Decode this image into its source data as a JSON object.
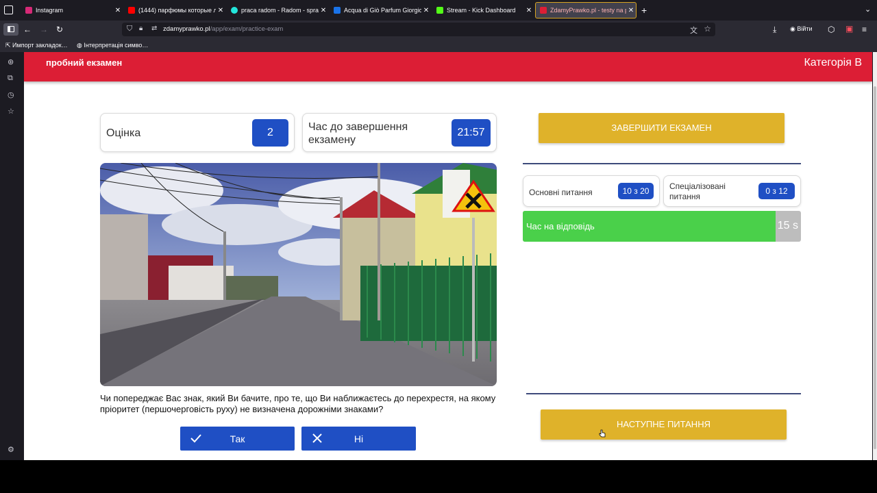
{
  "browser": {
    "tabs": [
      {
        "title": "Instagram",
        "color": "#d62976",
        "active": false
      },
      {
        "title": "(1444) парфюмы которые л",
        "color": "#ff0000",
        "active": false
      },
      {
        "title": "praca radom - Radom - spra",
        "color": "#23e5db",
        "active": false
      },
      {
        "title": "Acqua di Giò Parfum Giorgio",
        "color": "#1a73e8",
        "active": false
      },
      {
        "title": "Stream - Kick Dashboard",
        "color": "#53fc18",
        "active": false
      },
      {
        "title": "ZdamyPrawko.pl - testy na p",
        "color": "#dc1e35",
        "active": true
      }
    ],
    "url_host": "zdamyprawko.pl",
    "url_path": "/app/exam/practice-exam",
    "signin_label": "Війти",
    "bookmarks": [
      "Импорт закладок…",
      "Інтерпретація симво…"
    ]
  },
  "header": {
    "title": "пробний екзамен",
    "category": "Категорія B"
  },
  "score": {
    "label": "Оцінка",
    "value": "2"
  },
  "timer": {
    "label": "Час до завершення екзамену",
    "value": "21:57"
  },
  "question": {
    "text": "Чи попереджає Вас знак, який Ви бачите, про те, що Ви наближаєтесь до перехрестя, на якому пріоритет (першочерговість руху) не визначена дорожніми знаками?"
  },
  "answers": {
    "yes": "Так",
    "no": "Ні"
  },
  "finish_button": "ЗАВЕРШИТИ ЕКЗАМЕН",
  "next_button": "НАСТУПНЕ ПИТАННЯ",
  "basic_questions": {
    "label": "Основні питання",
    "value": "10 з 20"
  },
  "special_questions": {
    "label": "Спеціалізовані питання",
    "value": "0 з 12"
  },
  "answer_time": {
    "label": "Час на відповідь",
    "value": "15 s",
    "fraction_remaining": 0.91
  },
  "colors": {
    "header_red": "#dc1e35",
    "accent_blue": "#1f4fc4",
    "yellow": "#dfb22a",
    "green": "#4ad04a"
  }
}
